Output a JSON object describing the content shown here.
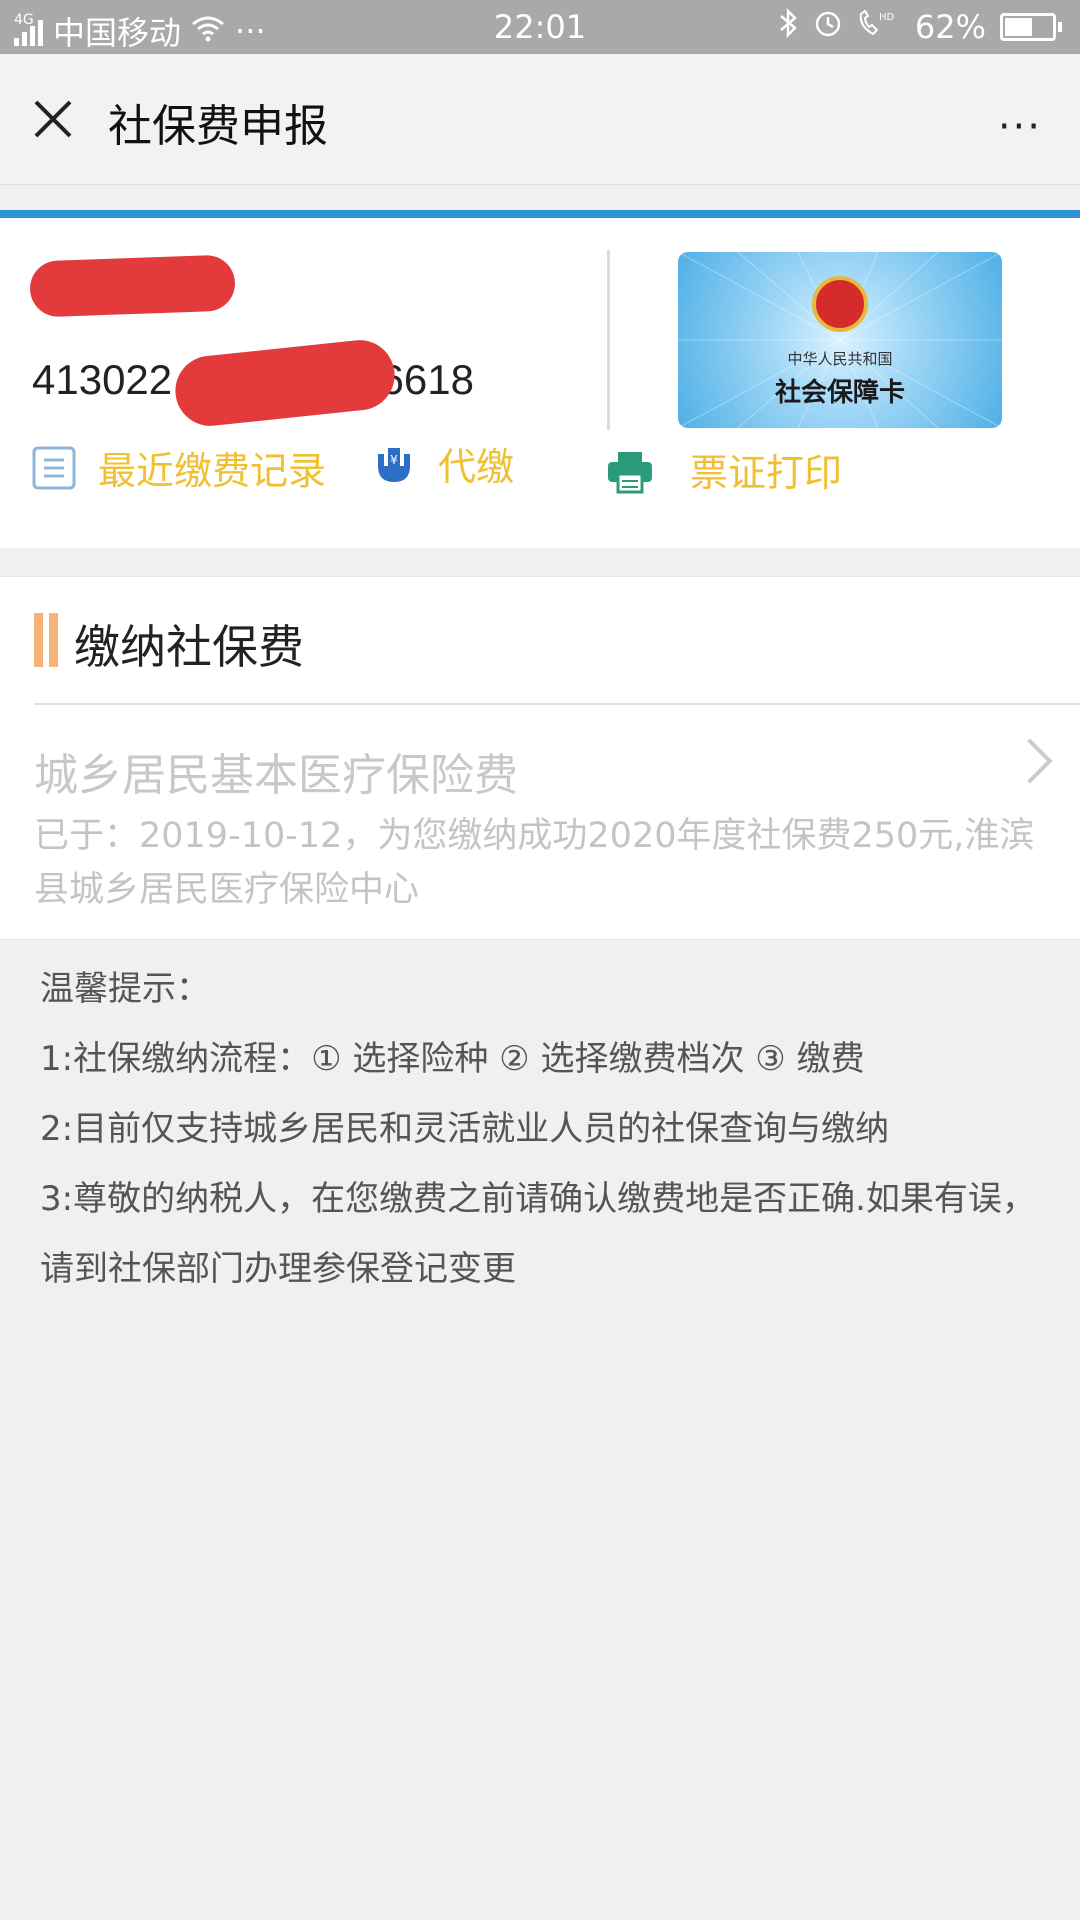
{
  "status_bar": {
    "network_type": "4G",
    "carrier": "中国移动",
    "more": "···",
    "time": "22:01",
    "battery_percent": "62%",
    "battery_level": 0.62,
    "icons": [
      "signal-icon",
      "wifi-icon",
      "bluetooth-icon",
      "alarm-icon",
      "hd-call-icon",
      "battery-icon"
    ]
  },
  "navbar": {
    "close_icon": "close-icon",
    "title": "社保费申报",
    "more_label": "···"
  },
  "card": {
    "id_prefix": "413022",
    "id_suffix": "56618",
    "social_card_line1": "中华人民共和国",
    "social_card_line2": "社会保障卡"
  },
  "actions": [
    {
      "label": "最近缴费记录",
      "icon": "list-icon"
    },
    {
      "label": "代缴",
      "icon": "yuan-hand-icon"
    },
    {
      "label": "票证打印",
      "icon": "printer-icon"
    }
  ],
  "section": {
    "title": "缴纳社保费",
    "item": {
      "title": "城乡居民基本医疗保险费",
      "description": "已于：2019-10-12，为您缴纳成功2020年度社保费250元,淮滨县城乡居民医疗保险中心"
    }
  },
  "tips": {
    "heading": "温馨提示：",
    "lines": [
      "1:社保缴纳流程：① 选择险种 ② 选择缴费档次 ③ 缴费",
      "2:目前仅支持城乡居民和灵活就业人员的社保查询与缴纳",
      "3:尊敬的纳税人，在您缴费之前请确认缴费地是否正确.如果有误，请到社保部门办理参保登记变更"
    ]
  },
  "colors": {
    "accent_blue": "#2d93d6",
    "action_yellow": "#f0c030",
    "redaction_red": "#e33b3b",
    "section_bar": "#f7b27a"
  }
}
